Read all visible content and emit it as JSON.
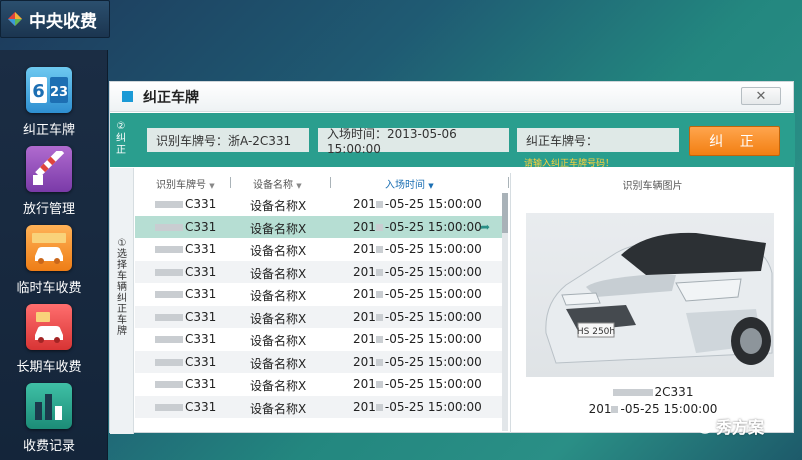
{
  "app": {
    "title": "中央收费"
  },
  "sidebar": {
    "items": [
      {
        "label": "纠正车牌",
        "icon": "plate-number-icon"
      },
      {
        "label": "放行管理",
        "icon": "barrier-gate-icon"
      },
      {
        "label": "临时车收费",
        "icon": "temporary-car-icon"
      },
      {
        "label": "长期车收费",
        "icon": "long-term-car-icon"
      },
      {
        "label": "收费记录",
        "icon": "chart-records-icon"
      }
    ]
  },
  "dialog": {
    "title": "纠正车牌",
    "close_label": "✕",
    "step2_label": "②纠正",
    "recognized_plate": "识别车牌号：浙A-2C331",
    "entry_time": "入场时间：2013-05-06 15:00:00",
    "corrected_plate_label": "纠正车牌号：",
    "hint": "请输入纠正车牌号码！",
    "fix_button": "纠 正",
    "step1_label": "①选择车辆纠正车牌",
    "table": {
      "headers": [
        "识别车牌号",
        "设备名称",
        "入场时间",
        "识别车辆图片"
      ],
      "rows": [
        {
          "plate": "C331",
          "device": "设备名称X",
          "time_a": "201",
          "time_b": "-05-25 15:00:00"
        },
        {
          "plate": "C331",
          "device": "设备名称X",
          "time_a": "201",
          "time_b": "-05-25 15:00:00",
          "selected": true
        },
        {
          "plate": "C331",
          "device": "设备名称X",
          "time_a": "201",
          "time_b": "-05-25 15:00:00"
        },
        {
          "plate": "C331",
          "device": "设备名称X",
          "time_a": "201",
          "time_b": "-05-25 15:00:00"
        },
        {
          "plate": "C331",
          "device": "设备名称X",
          "time_a": "201",
          "time_b": "-05-25 15:00:00"
        },
        {
          "plate": "C331",
          "device": "设备名称X",
          "time_a": "201",
          "time_b": "-05-25 15:00:00"
        },
        {
          "plate": "C331",
          "device": "设备名称X",
          "time_a": "201",
          "time_b": "-05-25 15:00:00"
        },
        {
          "plate": "C331",
          "device": "设备名称X",
          "time_a": "201",
          "time_b": "-05-25 15:00:00"
        },
        {
          "plate": "C331",
          "device": "设备名称X",
          "time_a": "201",
          "time_b": "-05-25 15:00:00"
        },
        {
          "plate": "C331",
          "device": "设备名称X",
          "time_a": "201",
          "time_b": "-05-25 15:00:00"
        }
      ]
    },
    "image_panel": {
      "plate_suffix": "2C331",
      "time_a": "201",
      "time_b": "-05-25 15:00:00",
      "car_plate": "HS 250h"
    }
  },
  "watermark": "秀方案",
  "colors": {
    "teal": "#2a9e8e",
    "orange": "#f27f12",
    "hint": "#ffd23c",
    "selected_row": "#b6ded3"
  }
}
